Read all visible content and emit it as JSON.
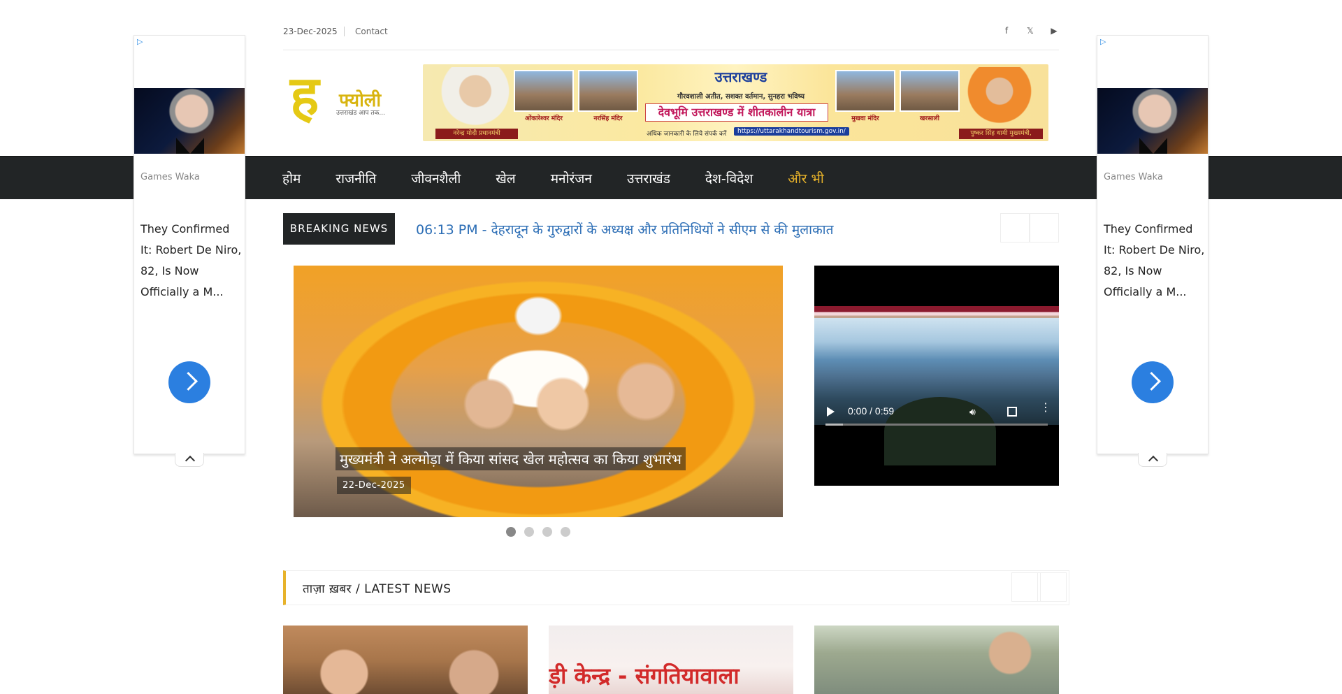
{
  "topbar": {
    "date": "23-Dec-2025",
    "contact": "Contact",
    "social": [
      "f",
      "𝕏",
      "▶"
    ]
  },
  "logo": {
    "mark": "ह",
    "word": "फ्योली",
    "tagline": "उत्तराखंड आप तक..."
  },
  "banner": {
    "brand": "उत्तराखण्ड",
    "slogan": "गौरवशाली अतीत, सशक्त वर्तमान, सुनहरा भविष्य",
    "headline": "देवभूमि उत्तराखण्ड में शीतकालीन यात्रा",
    "contact_line": "अधिक जानकारी के लिये संपर्क करें",
    "url": "https://uttarakhandtourism.gov.in/",
    "left_label": "नरेन्द्र मोदी प्रधानमंत्री",
    "right_label": "पुष्कर सिंह धामी मुख्यमंत्री, उत्तराखण्ड",
    "tiles": [
      {
        "caption": "ओंकारेश्वर मंदिर"
      },
      {
        "caption": "नरसिंह मंदिर"
      },
      {
        "caption": "मुखवा मंदिर"
      },
      {
        "caption": "खरसाली"
      }
    ]
  },
  "nav": {
    "items": [
      "होम",
      "राजनीति",
      "जीवनशैली",
      "खेल",
      "मनोरंजन",
      "उत्तराखंड",
      "देश-विदेश"
    ],
    "more": "और भी"
  },
  "side_ad": {
    "flag": "▷",
    "source": "Games Waka",
    "headline": "They Confirmed It: Robert De Niro, 82, Is Now Officially a M..."
  },
  "breaking": {
    "label": "BREAKING NEWS",
    "ticker": "06:13 PM - देहरादून के गुरुद्वारों के अध्यक्ष और प्रतिनिधियों ने सीएम से की मुलाकात"
  },
  "slider": {
    "caption": "मुख्यमंत्री ने अल्मोड़ा में किया सांसद खेल महोत्सव का किया शुभारंभ",
    "date": "22-Dec-2025",
    "dots": 4,
    "active": 0
  },
  "video": {
    "time": "0:00 / 0:59",
    "progress": 0.08
  },
  "latest": {
    "title": "ताज़ा ख़बर / LATEST NEWS",
    "card2_sign": "ड़ी केन्द्र - संगतियावाला"
  }
}
